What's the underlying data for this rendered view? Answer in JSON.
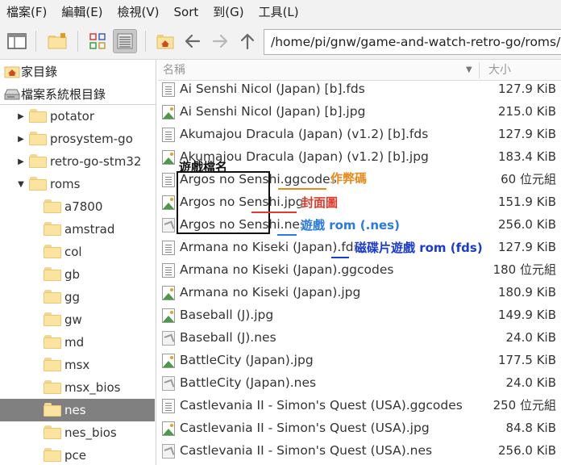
{
  "menu": [
    "檔案(F)",
    "編輯(E)",
    "檢視(V)",
    "Sort",
    "到(G)",
    "工具(L)"
  ],
  "toolbar": {
    "path": "/home/pi/gnw/game-and-watch-retro-go/roms/nes",
    "icons": [
      "window-icon",
      "new-folder-icon",
      "icon-view-icon",
      "list-view-icon",
      "home-icon",
      "back-arrow-icon",
      "forward-arrow-icon",
      "up-arrow-icon"
    ]
  },
  "places": [
    {
      "label": "家目錄",
      "icon": "home-icon"
    },
    {
      "label": "檔案系統根目錄",
      "icon": "drive-icon"
    }
  ],
  "tree": [
    {
      "label": "potator",
      "expander": "collapsed"
    },
    {
      "label": "prosystem-go",
      "expander": "collapsed"
    },
    {
      "label": "retro-go-stm32",
      "expander": "collapsed"
    },
    {
      "label": "roms",
      "expander": "expanded"
    },
    {
      "label": "a7800",
      "expander": ""
    },
    {
      "label": "amstrad",
      "expander": ""
    },
    {
      "label": "col",
      "expander": ""
    },
    {
      "label": "gb",
      "expander": ""
    },
    {
      "label": "gg",
      "expander": ""
    },
    {
      "label": "gw",
      "expander": ""
    },
    {
      "label": "md",
      "expander": ""
    },
    {
      "label": "msx",
      "expander": ""
    },
    {
      "label": "msx_bios",
      "expander": ""
    },
    {
      "label": "nes",
      "expander": "",
      "selected": true
    },
    {
      "label": "nes_bios",
      "expander": ""
    },
    {
      "label": "pce",
      "expander": ""
    }
  ],
  "list_header": {
    "name": "名稱",
    "size": "大小"
  },
  "files": [
    {
      "name": "Ai Senshi Nicol (Japan) [b].fds",
      "size": "127.9 KiB",
      "type": "text"
    },
    {
      "name": "Ai Senshi Nicol (Japan) [b].jpg",
      "size": "215.0 KiB",
      "type": "image"
    },
    {
      "name": "Akumajou Dracula (Japan) (v1.2) [b].fds",
      "size": "127.9 KiB",
      "type": "text"
    },
    {
      "name": "Akumajou Dracula (Japan) (v1.2) [b].jpg",
      "size": "183.4 KiB",
      "type": "image"
    },
    {
      "name": "Argos no Senshi.ggcodes",
      "size": "60 位元組",
      "type": "text"
    },
    {
      "name": "Argos no Senshi.jpg",
      "size": "151.9 KiB",
      "type": "image"
    },
    {
      "name": "Argos no Senshi.nes",
      "size": "256.0 KiB",
      "type": "nes"
    },
    {
      "name": "Armana no Kiseki (Japan).fds",
      "size": "127.9 KiB",
      "type": "text"
    },
    {
      "name": "Armana no Kiseki (Japan).ggcodes",
      "size": "180 位元組",
      "type": "text"
    },
    {
      "name": "Armana no Kiseki (Japan).jpg",
      "size": "180.9 KiB",
      "type": "image"
    },
    {
      "name": "Baseball (J).jpg",
      "size": "149.9 KiB",
      "type": "image"
    },
    {
      "name": "Baseball (J).nes",
      "size": "24.0 KiB",
      "type": "nes"
    },
    {
      "name": "BattleCity (Japan).jpg",
      "size": "177.5 KiB",
      "type": "image"
    },
    {
      "name": "BattleCity (Japan).nes",
      "size": "24.0 KiB",
      "type": "nes"
    },
    {
      "name": "Castlevania II - Simon's Quest (USA).ggcodes",
      "size": "250 位元組",
      "type": "text"
    },
    {
      "name": "Castlevania II - Simon's Quest (USA).jpg",
      "size": "84.8 KiB",
      "type": "image"
    },
    {
      "name": "Castlevania II - Simon's Quest (USA).nes",
      "size": "256.0 KiB",
      "type": "nes"
    }
  ],
  "annotations": {
    "title": "遊戲檔名",
    "cheat": {
      "text": "作弊碼",
      "color": "#e88a1a"
    },
    "cover": {
      "text": "封面圖",
      "color": "#e03a2a"
    },
    "rom": {
      "text": "遊戲 rom (.nes)",
      "color": "#2a7ae0"
    },
    "fds": {
      "text": "磁碟片遊戲 rom (fds)",
      "color": "#1a3ad0"
    }
  },
  "colors": {
    "selected_row": "#808080",
    "folder": "#fbe3a2"
  }
}
